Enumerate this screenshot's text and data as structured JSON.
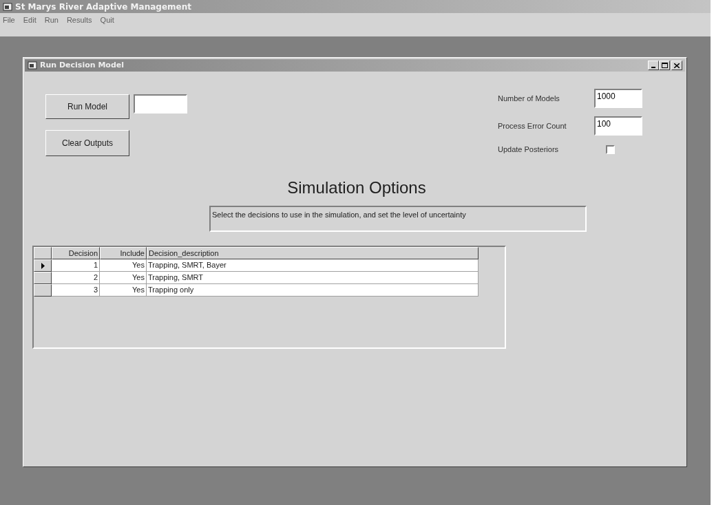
{
  "app_window": {
    "title": "St Marys River Adaptive Management"
  },
  "menu": [
    "File",
    "Edit",
    "Run",
    "Results",
    "Quit"
  ],
  "child_window": {
    "title": "Run Decision Model"
  },
  "buttons": [
    "Run Model",
    "Clear Outputs"
  ],
  "settings": [
    {
      "kind": "field",
      "label": "Number of Models",
      "value": "1000"
    },
    {
      "kind": "field",
      "label": "Process Error Count",
      "value": "100"
    },
    {
      "kind": "checkbox",
      "label": "Update Posteriors",
      "checked": false
    }
  ],
  "heading": "Simulation Options",
  "description": "Select the decisions to use in the simulation, and set the level of uncertainty",
  "table": {
    "columns": [
      "Decision",
      "Include",
      "Decision_description"
    ],
    "rows": [
      {
        "selected": true,
        "cells": [
          "1",
          "Yes",
          "Trapping, SMRT, Bayer"
        ]
      },
      {
        "selected": false,
        "cells": [
          "2",
          "Yes",
          "Trapping, SMRT"
        ]
      },
      {
        "selected": false,
        "cells": [
          "3",
          "Yes",
          "Trapping only"
        ]
      }
    ]
  }
}
